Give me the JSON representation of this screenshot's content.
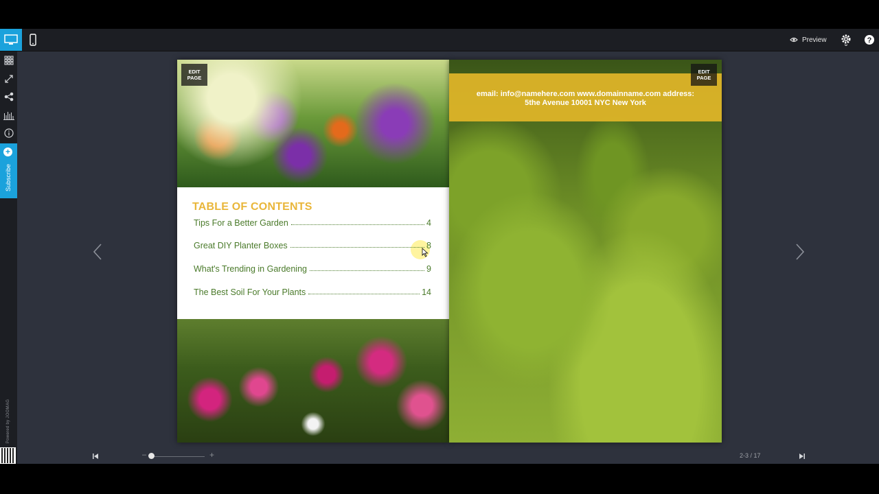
{
  "topbar": {
    "preview_label": "Preview"
  },
  "sidebar": {
    "subscribe_label": "Subscribe",
    "powered_by": "Powered by JOOMAG"
  },
  "left_page": {
    "edit_label_1": "EDIT",
    "edit_label_2": "PAGE",
    "toc": {
      "title": "TABLE OF CONTENTS",
      "items": [
        {
          "label": "Tips For a Better Garden",
          "page": "4"
        },
        {
          "label": "Great DIY Planter Boxes",
          "page": "8"
        },
        {
          "label": "What's Trending in Gardening",
          "page": "9"
        },
        {
          "label": "The Best Soil For Your Plants",
          "page": "14"
        }
      ]
    }
  },
  "right_page": {
    "edit_label_1": "EDIT",
    "edit_label_2": "PAGE",
    "contact_line1": "email: info@namehere.com  www.domainname.com address:",
    "contact_line2": "5the Avenue 10001 NYC New York"
  },
  "bottombar": {
    "zoom_minus": "–",
    "zoom_plus": "+",
    "page_indicator": "2-3 / 17"
  },
  "colors": {
    "accent": "#1ba2dc",
    "toc_title": "#e9b63a",
    "toc_text": "#4a7a2a",
    "banner": "#e2b628",
    "stage": "#2e323d"
  }
}
